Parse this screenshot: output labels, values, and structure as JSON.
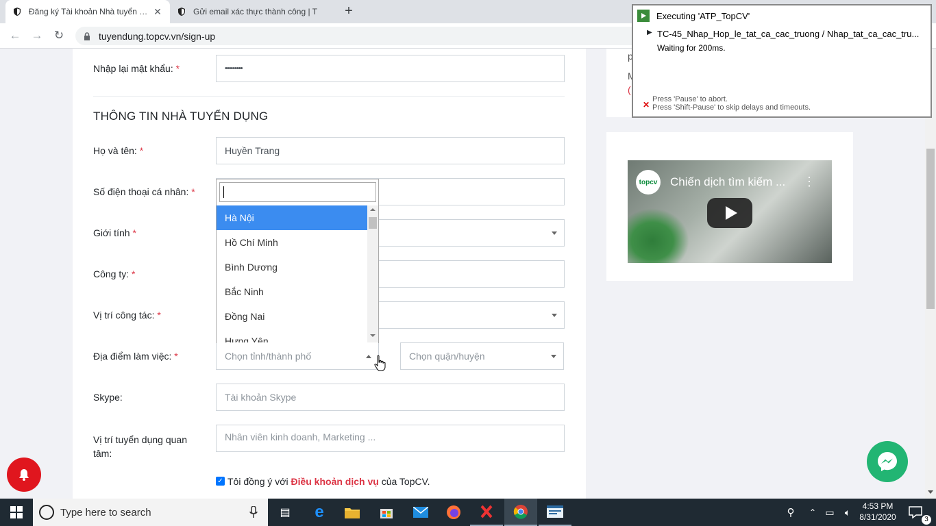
{
  "browser": {
    "tabs": [
      {
        "title": "Đăng ký Tài khoản Nhà tuyển dụ",
        "active": true
      },
      {
        "title": "Gửi email xác thực thành công | T",
        "active": false
      }
    ],
    "url": "tuyendung.topcv.vn/sign-up"
  },
  "form": {
    "confirm_password": {
      "label": "Nhập lại mật khẩu:",
      "required": "*",
      "value": "•••••••••"
    },
    "section_title": "THÔNG TIN NHÀ TUYỂN DỤNG",
    "full_name": {
      "label": "Họ và tên:",
      "required": "*",
      "value": "Huyền Trang"
    },
    "phone": {
      "label": "Số điện thoại cá nhân:",
      "required": "*"
    },
    "gender": {
      "label": "Giới tính",
      "required": "*"
    },
    "company": {
      "label": "Công ty:",
      "required": "*"
    },
    "position": {
      "label": "Vị trí công tác:",
      "required": "*"
    },
    "work_location": {
      "label": "Địa điểm làm việc:",
      "required": "*",
      "province_placeholder": "Chọn tỉnh/thành phố",
      "district_placeholder": "Chọn quận/huyện"
    },
    "skype": {
      "label": "Skype:",
      "placeholder": "Tài khoản Skype"
    },
    "interest": {
      "label_line1": "Vị trí tuyển dụng quan",
      "label_line2": "tâm:",
      "placeholder": "Nhân viên kinh doanh, Marketing ..."
    },
    "agree": {
      "prefix": "Tôi đồng ý với ",
      "link": "Điều khoản dịch vụ",
      "suffix": " của TopCV."
    }
  },
  "province_dropdown": {
    "search_value": "",
    "options": [
      "Hà Nội",
      "Hồ Chí Minh",
      "Bình Dương",
      "Bắc Ninh",
      "Đồng Nai",
      "Hưng Yên"
    ],
    "highlighted_index": 0
  },
  "video": {
    "logo_text": "topcv",
    "title": "Chiến dịch tìm kiếm ..."
  },
  "automation_panel": {
    "title": "Executing 'ATP_TopCV'",
    "task": "TC-45_Nhap_Hop_le_tat_ca_cac_truong  /  Nhap_tat_ca_cac_tru...",
    "status": "Waiting for 200ms.",
    "hint1": "Press 'Pause' to abort.",
    "hint2": "Press 'Shift-Pause' to skip delays and timeouts."
  },
  "right_partial": {
    "c1": "p",
    "c2": "M",
    "c3": "("
  },
  "taskbar": {
    "search_placeholder": "Type here to search",
    "time": "4:53 PM",
    "date": "8/31/2020",
    "notifications": "3"
  },
  "colors": {
    "accent": "#3b8cf0",
    "required": "#dc3545",
    "messenger": "#22b573",
    "bell": "#e0161e"
  }
}
